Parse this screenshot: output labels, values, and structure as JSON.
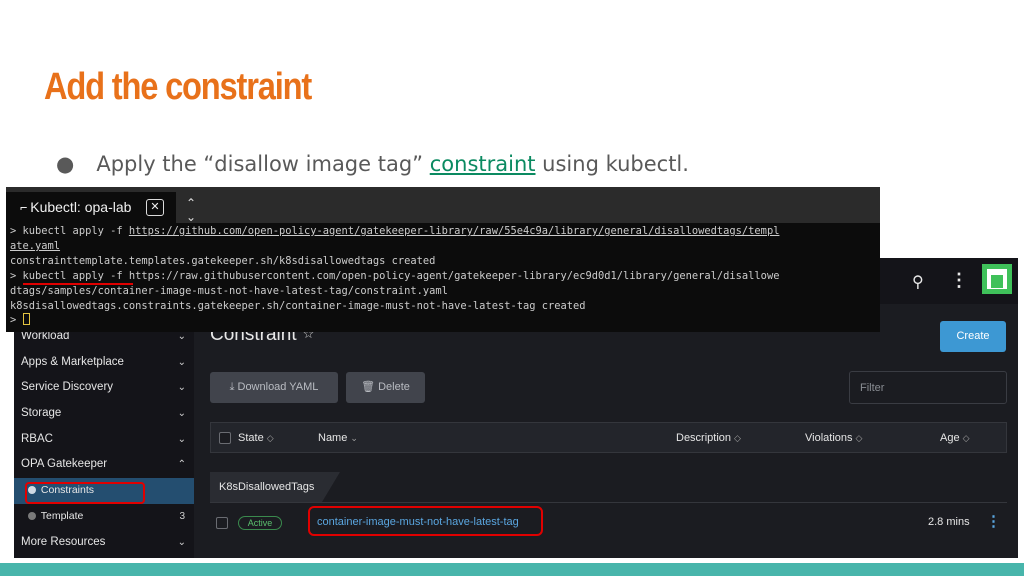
{
  "slide": {
    "title": "Add the constraint",
    "bullet_before": "Apply the “disallow image tag” ",
    "bullet_link": "constraint",
    "bullet_after": " using kubectl.",
    "accent_color": "#e8711a",
    "bottom_bar_color": "#48b5ab"
  },
  "terminal": {
    "tab_label": "Kubectl: opa-lab",
    "tab_icon": "powershell-icon",
    "lines": [
      {
        "prefix": "> kubectl apply -f ",
        "link": "https://github.com/open-policy-agent/gatekeeper-library/raw/55e4c9a/library/general/disallowedtags/templ"
      },
      {
        "prefix": "",
        "link": "ate.yaml"
      },
      {
        "prefix": "constrainttemplate.templates.gatekeeper.sh/k8sdisallowedtags created",
        "link": ""
      },
      {
        "prefix": "> kubectl apply -f https://raw.githubusercontent.com/open-policy-agent/gatekeeper-library/ec9d0d1/library/general/disallowe",
        "link": ""
      },
      {
        "prefix": "dtags/samples/container-image-must-not-have-latest-tag/constraint.yaml",
        "link": ""
      },
      {
        "prefix": "k8sdisallowedtags.constraints.gatekeeper.sh/container-image-must-not-have-latest-tag created",
        "link": ""
      }
    ],
    "prompt": "> "
  },
  "sidebar": {
    "items": [
      {
        "label": "Workload",
        "chevron": "⌄"
      },
      {
        "label": "Apps & Marketplace",
        "chevron": "⌄"
      },
      {
        "label": "Service Discovery",
        "chevron": "⌄"
      },
      {
        "label": "Storage",
        "chevron": "⌄"
      },
      {
        "label": "RBAC",
        "chevron": "⌄"
      },
      {
        "label": "OPA Gatekeeper",
        "chevron": "⌃"
      }
    ],
    "sub_items": [
      {
        "label": "Constraints",
        "count": ""
      },
      {
        "label": "Template",
        "count": "3"
      }
    ],
    "more": {
      "label": "More Resources",
      "chevron": "⌄"
    }
  },
  "main": {
    "page_title": "Constraint",
    "create_label": "Create",
    "download_label": "⤓ Download YAML",
    "delete_label": "🗑 Delete",
    "filter_placeholder": "Filter",
    "columns": {
      "state": "State",
      "name": "Name",
      "description": "Description",
      "violations": "Violations",
      "age": "Age"
    },
    "group_label": "K8sDisallowedTags",
    "row": {
      "state": "Active",
      "name": "container-image-must-not-have-latest-tag",
      "age": "2.8 mins"
    }
  }
}
